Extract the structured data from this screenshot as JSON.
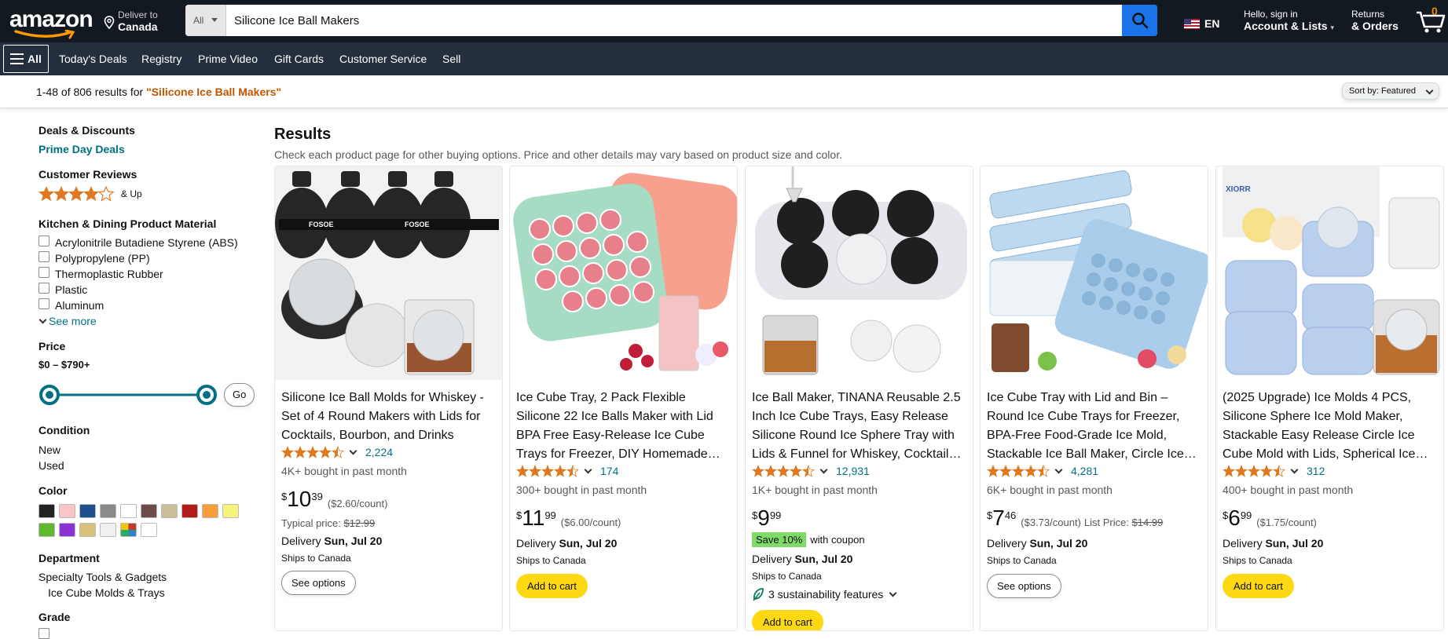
{
  "header": {
    "logo": "amazon",
    "deliver_to": "Deliver to",
    "deliver_location": "Canada",
    "search_category": "All",
    "search_value": "Silicone Ice Ball Makers",
    "language": "EN",
    "account_line1": "Hello, sign in",
    "account_line2": "Account & Lists",
    "returns_line1": "Returns",
    "returns_line2": "& Orders",
    "cart_count": "0"
  },
  "nav": {
    "all": "All",
    "items": [
      "Today's Deals",
      "Registry",
      "Prime Video",
      "Gift Cards",
      "Customer Service",
      "Sell"
    ]
  },
  "results_bar": {
    "count": "1-48 of 806 results for ",
    "query": "\"Silicone Ice Ball Makers\"",
    "sort_label": "Sort by:",
    "sort_value": "Featured"
  },
  "sidebar": {
    "deals_heading": "Deals & Discounts",
    "prime_day": "Prime Day Deals",
    "reviews_heading": "Customer Reviews",
    "reviews_up": "& Up",
    "material_heading": "Kitchen & Dining Product Material",
    "materials": [
      "Acrylonitrile Butadiene Styrene (ABS)",
      "Polypropylene (PP)",
      "Thermoplastic Rubber",
      "Plastic",
      "Aluminum"
    ],
    "see_more": "See more",
    "price_heading": "Price",
    "price_range": "$0 – $790+",
    "go": "Go",
    "condition_heading": "Condition",
    "conditions": [
      "New",
      "Used"
    ],
    "color_heading": "Color",
    "colors": [
      "#222222",
      "#f9c5c9",
      "#1f4e8c",
      "#8a8a8a",
      "#ffffff",
      "#6e4b4b",
      "#cbbf9a",
      "#b31b1b",
      "#f79e3b",
      "#f8f37a",
      "#5fb82e",
      "#8b31d6",
      "#d8c27a",
      "#f0f0f0",
      "#multi",
      "#ffffff"
    ],
    "department_heading": "Department",
    "department_parent": "Specialty Tools & Gadgets",
    "department_child": "Ice Cube Molds & Trays",
    "grade_heading": "Grade"
  },
  "main": {
    "heading": "Results",
    "subheading": "Check each product page for other buying options. Price and other details may vary based on product size and color."
  },
  "products": [
    {
      "title": "Silicone Ice Ball Molds for Whiskey - Set of 4 Round Makers with Lids for Cocktails, Bourbon, and Drinks",
      "rating": 4.5,
      "reviews": "2,224",
      "bought": "4K+ bought in past month",
      "price_whole": "10",
      "price_frac": "39",
      "unit": "($2.60/count)",
      "typical_label": "Typical price:",
      "typical_price": "$12.99",
      "delivery_label": "Delivery",
      "delivery_date": "Sun, Jul 20",
      "ships": "Ships to Canada",
      "button": "See options"
    },
    {
      "title": "Ice Cube Tray, 2 Pack Flexible Silicone 22 Ice Balls Maker with Lid BPA Free Easy-Release Ice Cube Trays for Freezer, DIY Homemade Round Ice…",
      "rating": 4.5,
      "reviews": "174",
      "bought": "300+ bought in past month",
      "price_whole": "11",
      "price_frac": "99",
      "unit": "($6.00/count)",
      "delivery_label": "Delivery",
      "delivery_date": "Sun, Jul 20",
      "ships": "Ships to Canada",
      "button": "Add to cart"
    },
    {
      "title": "Ice Ball Maker, TINANA Reusable 2.5 Inch Ice Cube Trays, Easy Release Silicone Round Ice Sphere Tray with Lids & Funnel for Whiskey, Cocktail…",
      "rating": 4.5,
      "reviews": "12,931",
      "bought": "1K+ bought in past month",
      "price_whole": "9",
      "price_frac": "99",
      "save_badge": "Save 10%",
      "save_text": "with coupon",
      "delivery_label": "Delivery",
      "delivery_date": "Sun, Jul 20",
      "ships": "Ships to Canada",
      "sustainability": "3 sustainability features",
      "button": "Add to cart"
    },
    {
      "title": "Ice Cube Tray with Lid and Bin – Round Ice Cube Trays for Freezer, BPA-Free Food-Grade Ice Mold, Stackable Ice Ball Maker, Circle Ice…",
      "rating": 4.5,
      "reviews": "4,281",
      "bought": "6K+ bought in past month",
      "price_whole": "7",
      "price_frac": "46",
      "unit": "($3.73/count)",
      "list_label": "List Price:",
      "list_price": "$14.99",
      "delivery_label": "Delivery",
      "delivery_date": "Sun, Jul 20",
      "ships": "Ships to Canada",
      "button": "See options"
    },
    {
      "title": "(2025 Upgrade) Ice Molds 4 PCS, Silicone Sphere Ice Mold Maker, Stackable Easy Release Circle Ice Cube Mold with Lids, Spherical Ice…",
      "rating": 4.5,
      "reviews": "312",
      "bought": "400+ bought in past month",
      "price_whole": "6",
      "price_frac": "99",
      "unit": "($1.75/count)",
      "delivery_label": "Delivery",
      "delivery_date": "Sun, Jul 20",
      "ships": "Ships to Canada",
      "button": "Add to cart"
    }
  ],
  "product_image_text": {
    "brand_1": "FOSOE",
    "brand_5": "XIORR"
  }
}
